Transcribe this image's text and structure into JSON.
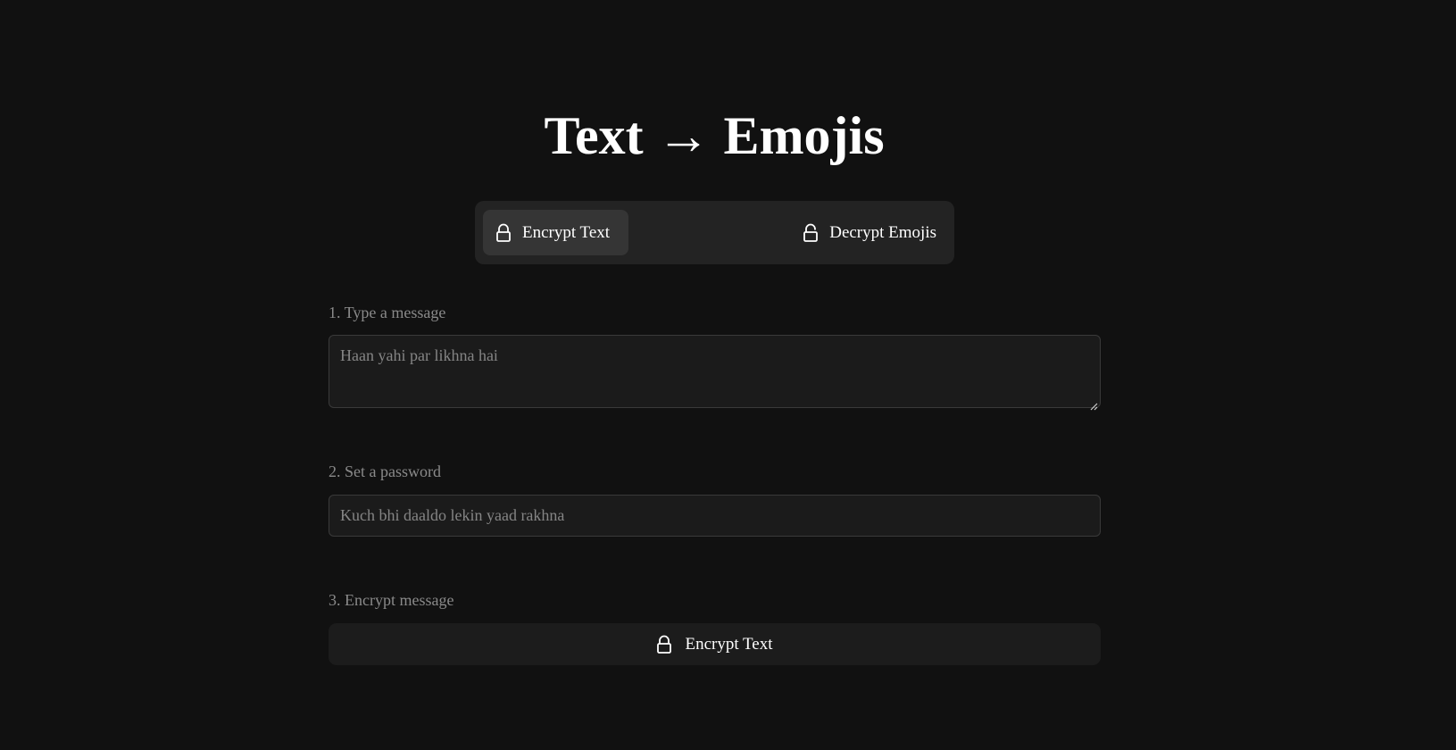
{
  "header": {
    "title": "Text → Emojis"
  },
  "mode_switch": {
    "encrypt_label": "Encrypt Text",
    "decrypt_label": "Decrypt Emojis",
    "active": "encrypt"
  },
  "steps": {
    "message": {
      "label": "1. Type a message",
      "placeholder": "Haan yahi par likhna hai",
      "value": ""
    },
    "password": {
      "label": "2. Set a password",
      "placeholder": "Kuch bhi daaldo lekin yaad rakhna",
      "value": ""
    },
    "encrypt": {
      "label": "3. Encrypt message",
      "button_label": "Encrypt Text"
    }
  },
  "icons": {
    "locked": "lock-closed-icon",
    "unlocked": "lock-open-icon"
  },
  "colors": {
    "background": "#111111",
    "panel": "#232323",
    "active_tab": "#353535",
    "field": "#1b1b1b",
    "muted_text": "#8a8a8a",
    "text": "#ffffff"
  }
}
